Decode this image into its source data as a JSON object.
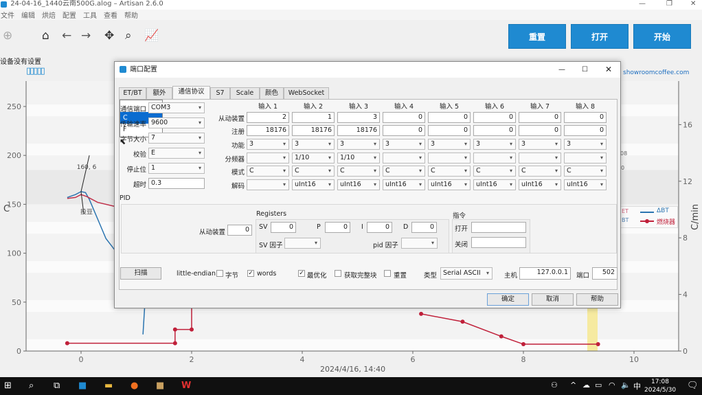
{
  "window": {
    "title": "24-04-16_1440云南500G.alog – Artisan 2.6.0"
  },
  "menu": [
    "文件",
    "编辑",
    "烘焙",
    "配置",
    "工具",
    "查看",
    "帮助"
  ],
  "toolbar": {
    "reset": "重置",
    "open": "打开",
    "start": "开始"
  },
  "status": {
    "device_msg": "设备没有设置",
    "lcd": "▯▯▯▯▯"
  },
  "chart_data": {
    "type": "line",
    "xlabel": "2024/4/16, 14:40",
    "ylabel": "C",
    "y2label": "C/min",
    "xticks": [
      0,
      2,
      4,
      6,
      8,
      10
    ],
    "yticks": [
      0,
      50,
      100,
      150,
      200,
      250
    ],
    "y2ticks": [
      0,
      4,
      8,
      12,
      16
    ],
    "xlim": [
      -1.4,
      10.4
    ],
    "ylim": [
      0,
      262
    ],
    "y2lim": [
      0,
      18.2
    ],
    "series": [
      {
        "name": "BT",
        "color": "#2a74b0",
        "points": [
          [
            -0.25,
            157
          ],
          [
            -0.1,
            160
          ],
          [
            0,
            163
          ],
          [
            0.08,
            162
          ],
          [
            0.15,
            155
          ],
          [
            0.3,
            135
          ],
          [
            0.45,
            115
          ],
          [
            0.6,
            104
          ],
          [
            0.75,
            97
          ],
          [
            0.9,
            94
          ]
        ]
      },
      {
        "name": "ET",
        "color": "#c0304a",
        "points": [
          [
            -0.25,
            156
          ],
          [
            -0.1,
            157
          ],
          [
            0,
            160
          ],
          [
            0.1,
            158
          ],
          [
            0.3,
            152
          ],
          [
            0.6,
            148
          ],
          [
            0.9,
            148
          ]
        ]
      },
      {
        "name": "BT-tail",
        "color": "#2a74b0",
        "points": [
          [
            1.12,
            17
          ],
          [
            1.15,
            45
          ]
        ]
      },
      {
        "name": "燃烧器",
        "color": "#c0203a",
        "step": true,
        "points": [
          [
            -0.25,
            8
          ],
          [
            1.7,
            8
          ],
          [
            1.7,
            22
          ],
          [
            2.0,
            22
          ],
          [
            2.0,
            50
          ]
        ]
      },
      {
        "name": "燃烧器-tail",
        "color": "#c0203a",
        "step": true,
        "points": [
          [
            6.15,
            38
          ],
          [
            6.9,
            30
          ],
          [
            7.6,
            15
          ],
          [
            8.0,
            7
          ],
          [
            9.35,
            7
          ]
        ]
      }
    ],
    "annotations": [
      {
        "text": "160, 6"
      },
      {
        "text": "投豆"
      }
    ],
    "legend": {
      "placement": "right",
      "entries": [
        "ET",
        "BT",
        "ΔBT",
        "燃烧器"
      ]
    },
    "watermark": "showroomcoffee.com",
    "partial_labels": [
      "08",
      "0"
    ]
  },
  "dialog": {
    "title": "端口配置",
    "tabs": [
      "ET/BT",
      "额外",
      "通信协议",
      "S7",
      "Scale",
      "颜色",
      "WebSocket"
    ],
    "serial": [
      {
        "label": "通信端口",
        "value": "COM3",
        "type": "combo"
      },
      {
        "label": "传输速率",
        "value": "9600",
        "type": "combo"
      },
      {
        "label": "字节大小",
        "value": "7",
        "type": "combo"
      },
      {
        "label": "校验",
        "value": "E",
        "type": "combo"
      },
      {
        "label": "停止位",
        "value": "1",
        "type": "combo"
      },
      {
        "label": "超时",
        "value": "0.3",
        "type": "field"
      }
    ],
    "row_labels": [
      "从动装置",
      "注册",
      "功能",
      "分频器",
      "模式",
      "解码"
    ],
    "inputs": [
      {
        "name": "输入 1",
        "slave": "2",
        "register": "18176",
        "function": "3",
        "divider": "",
        "mode": "C",
        "decode": ""
      },
      {
        "name": "输入 2",
        "slave": "1",
        "register": "18176",
        "function": "3",
        "divider": "1/10",
        "mode": "C",
        "decode": "uInt16"
      },
      {
        "name": "输入 3",
        "slave": "3",
        "register": "18176",
        "function": "3",
        "divider": "1/10",
        "mode": "C",
        "decode": "uInt16"
      },
      {
        "name": "输入 4",
        "slave": "0",
        "register": "0",
        "function": "3",
        "divider": "",
        "mode": "C",
        "decode": "uInt16"
      },
      {
        "name": "输入 5",
        "slave": "0",
        "register": "0",
        "function": "3",
        "divider": "",
        "mode": "C",
        "decode": "uInt16"
      },
      {
        "name": "输入 6",
        "slave": "0",
        "register": "0",
        "function": "3",
        "divider": "",
        "mode": "C",
        "decode": "uInt16"
      },
      {
        "name": "输入 7",
        "slave": "0",
        "register": "0",
        "function": "3",
        "divider": "",
        "mode": "C",
        "decode": "uInt16"
      },
      {
        "name": "输入 8",
        "slave": "0",
        "register": "0",
        "function": "3",
        "divider": "",
        "mode": "C",
        "decode": "uInt16"
      }
    ],
    "popup": {
      "options": [
        "",
        "C",
        "F"
      ],
      "selected": "C"
    },
    "pid": {
      "title": "PID",
      "slave_label": "从动装置",
      "slave": "0",
      "registers_title": "Registers",
      "sv_label": "SV",
      "sv": "0",
      "p_label": "P",
      "p": "0",
      "i_label": "I",
      "i": "0",
      "d_label": "D",
      "d": "0",
      "sv_factor_label": "SV 因子",
      "sv_factor": "",
      "pid_factor_label": "pid 因子",
      "pid_factor": "",
      "cmd_title": "指令",
      "on_label": "打开",
      "on": "",
      "off_label": "关闭",
      "off": ""
    },
    "bottom": {
      "scan": "扫描",
      "little_endian": "little-endian",
      "byte_label": "字节",
      "byte_checked": false,
      "words_label": "words",
      "words_checked": true,
      "optimize_label": "最优化",
      "optimize_checked": true,
      "fetch_label": "获取完整块",
      "fetch_checked": false,
      "reset_label": "重置",
      "reset_checked": false,
      "type_label": "类型",
      "type": "Serial ASCII",
      "host_label": "主机",
      "host": "127.0.0.1",
      "port_label": "端口",
      "port": "502"
    },
    "ok": "确定",
    "cancel": "取消",
    "help": "帮助"
  },
  "taskbar": {
    "time": "17:08",
    "date": "2024/5/30",
    "ime": "中"
  }
}
